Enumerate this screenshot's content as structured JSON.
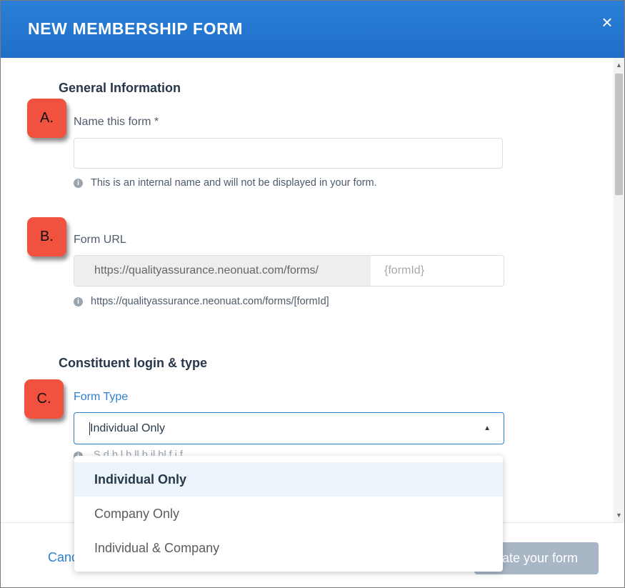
{
  "dialog": {
    "title": "NEW MEMBERSHIP FORM",
    "close_glyph": "×"
  },
  "general": {
    "section_title": "General Information",
    "name_label": "Name this form *",
    "name_value": "",
    "name_hint": "This is an internal name and will not be displayed in your form.",
    "url_label": "Form URL",
    "url_prefix": "https://qualityassurance.neonuat.com/forms/",
    "url_placeholder": "{formId}",
    "url_hint": "https://qualityassurance.neonuat.com/forms/[formId]"
  },
  "constituent": {
    "section_title": "Constituent login & type",
    "form_type_label": "Form Type",
    "form_type_value": "Individual Only",
    "form_type_hint_partial": "S                   d  b   l        b                ll    b    il  bl   f        i  f"
  },
  "dropdown": {
    "options": [
      {
        "label": "Individual Only",
        "selected": true
      },
      {
        "label": "Company Only",
        "selected": false
      },
      {
        "label": "Individual & Company",
        "selected": false
      }
    ]
  },
  "badges": [
    "A.",
    "B.",
    "C."
  ],
  "footer": {
    "cancel_label": "Canc",
    "create_label": "eate your form"
  },
  "icons": {
    "info": "info-circle-icon",
    "close": "close-icon",
    "dropdown": "caret-up-icon"
  },
  "colors": {
    "header": "#1f6fc9",
    "accent": "#2f7fd0",
    "badge": "#f0523f",
    "create_button_disabled": "#a9b6c6"
  }
}
